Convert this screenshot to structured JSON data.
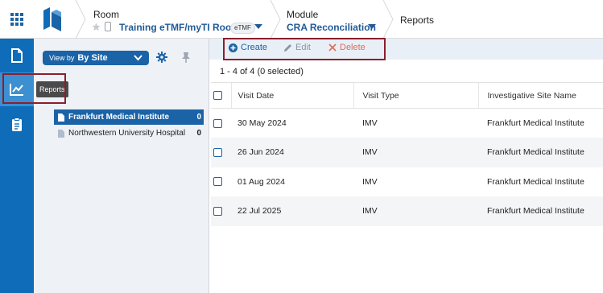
{
  "topbar": {
    "apps_icon": "grid-icon",
    "room_label": "Room",
    "room_value": "Training eTMF/myTI Room",
    "room_badge": "eTMF",
    "module_label": "Module",
    "module_value": "CRA Reconciliation",
    "page_title": "Reports"
  },
  "rail": {
    "items": [
      {
        "icon": "document-icon",
        "label": "Documents"
      },
      {
        "icon": "chart-line-icon",
        "label": "Reports",
        "active": true
      },
      {
        "icon": "clipboard-icon",
        "label": "Tasks"
      }
    ],
    "tooltip": "Reports"
  },
  "sidebar": {
    "viewby_prefix": "View by",
    "viewby_value": "By Site",
    "sites": [
      {
        "name": "Frankfurt Medical Institute",
        "count": "0",
        "selected": true
      },
      {
        "name": "Northwestern University Hospital",
        "count": "0",
        "selected": false
      }
    ]
  },
  "toolbar": {
    "create_label": "Create",
    "edit_label": "Edit",
    "delete_label": "Delete"
  },
  "grid": {
    "count_text": "1 - 4 of 4 (0 selected)",
    "columns": [
      "Visit Date",
      "Visit Type",
      "Investigative Site Name"
    ],
    "rows": [
      {
        "date": "30 May 2024",
        "type": "IMV",
        "site": "Frankfurt Medical Institute"
      },
      {
        "date": "26 Jun 2024",
        "type": "IMV",
        "site": "Frankfurt Medical Institute"
      },
      {
        "date": "01 Aug 2024",
        "type": "IMV",
        "site": "Frankfurt Medical Institute"
      },
      {
        "date": "22 Jul 2025",
        "type": "IMV",
        "site": "Frankfurt Medical Institute"
      }
    ]
  },
  "colors": {
    "brand_blue": "#0f6cb8",
    "link_blue": "#1f5a96",
    "delete_red": "#e06a5c",
    "highlight": "#8b1f2c"
  }
}
